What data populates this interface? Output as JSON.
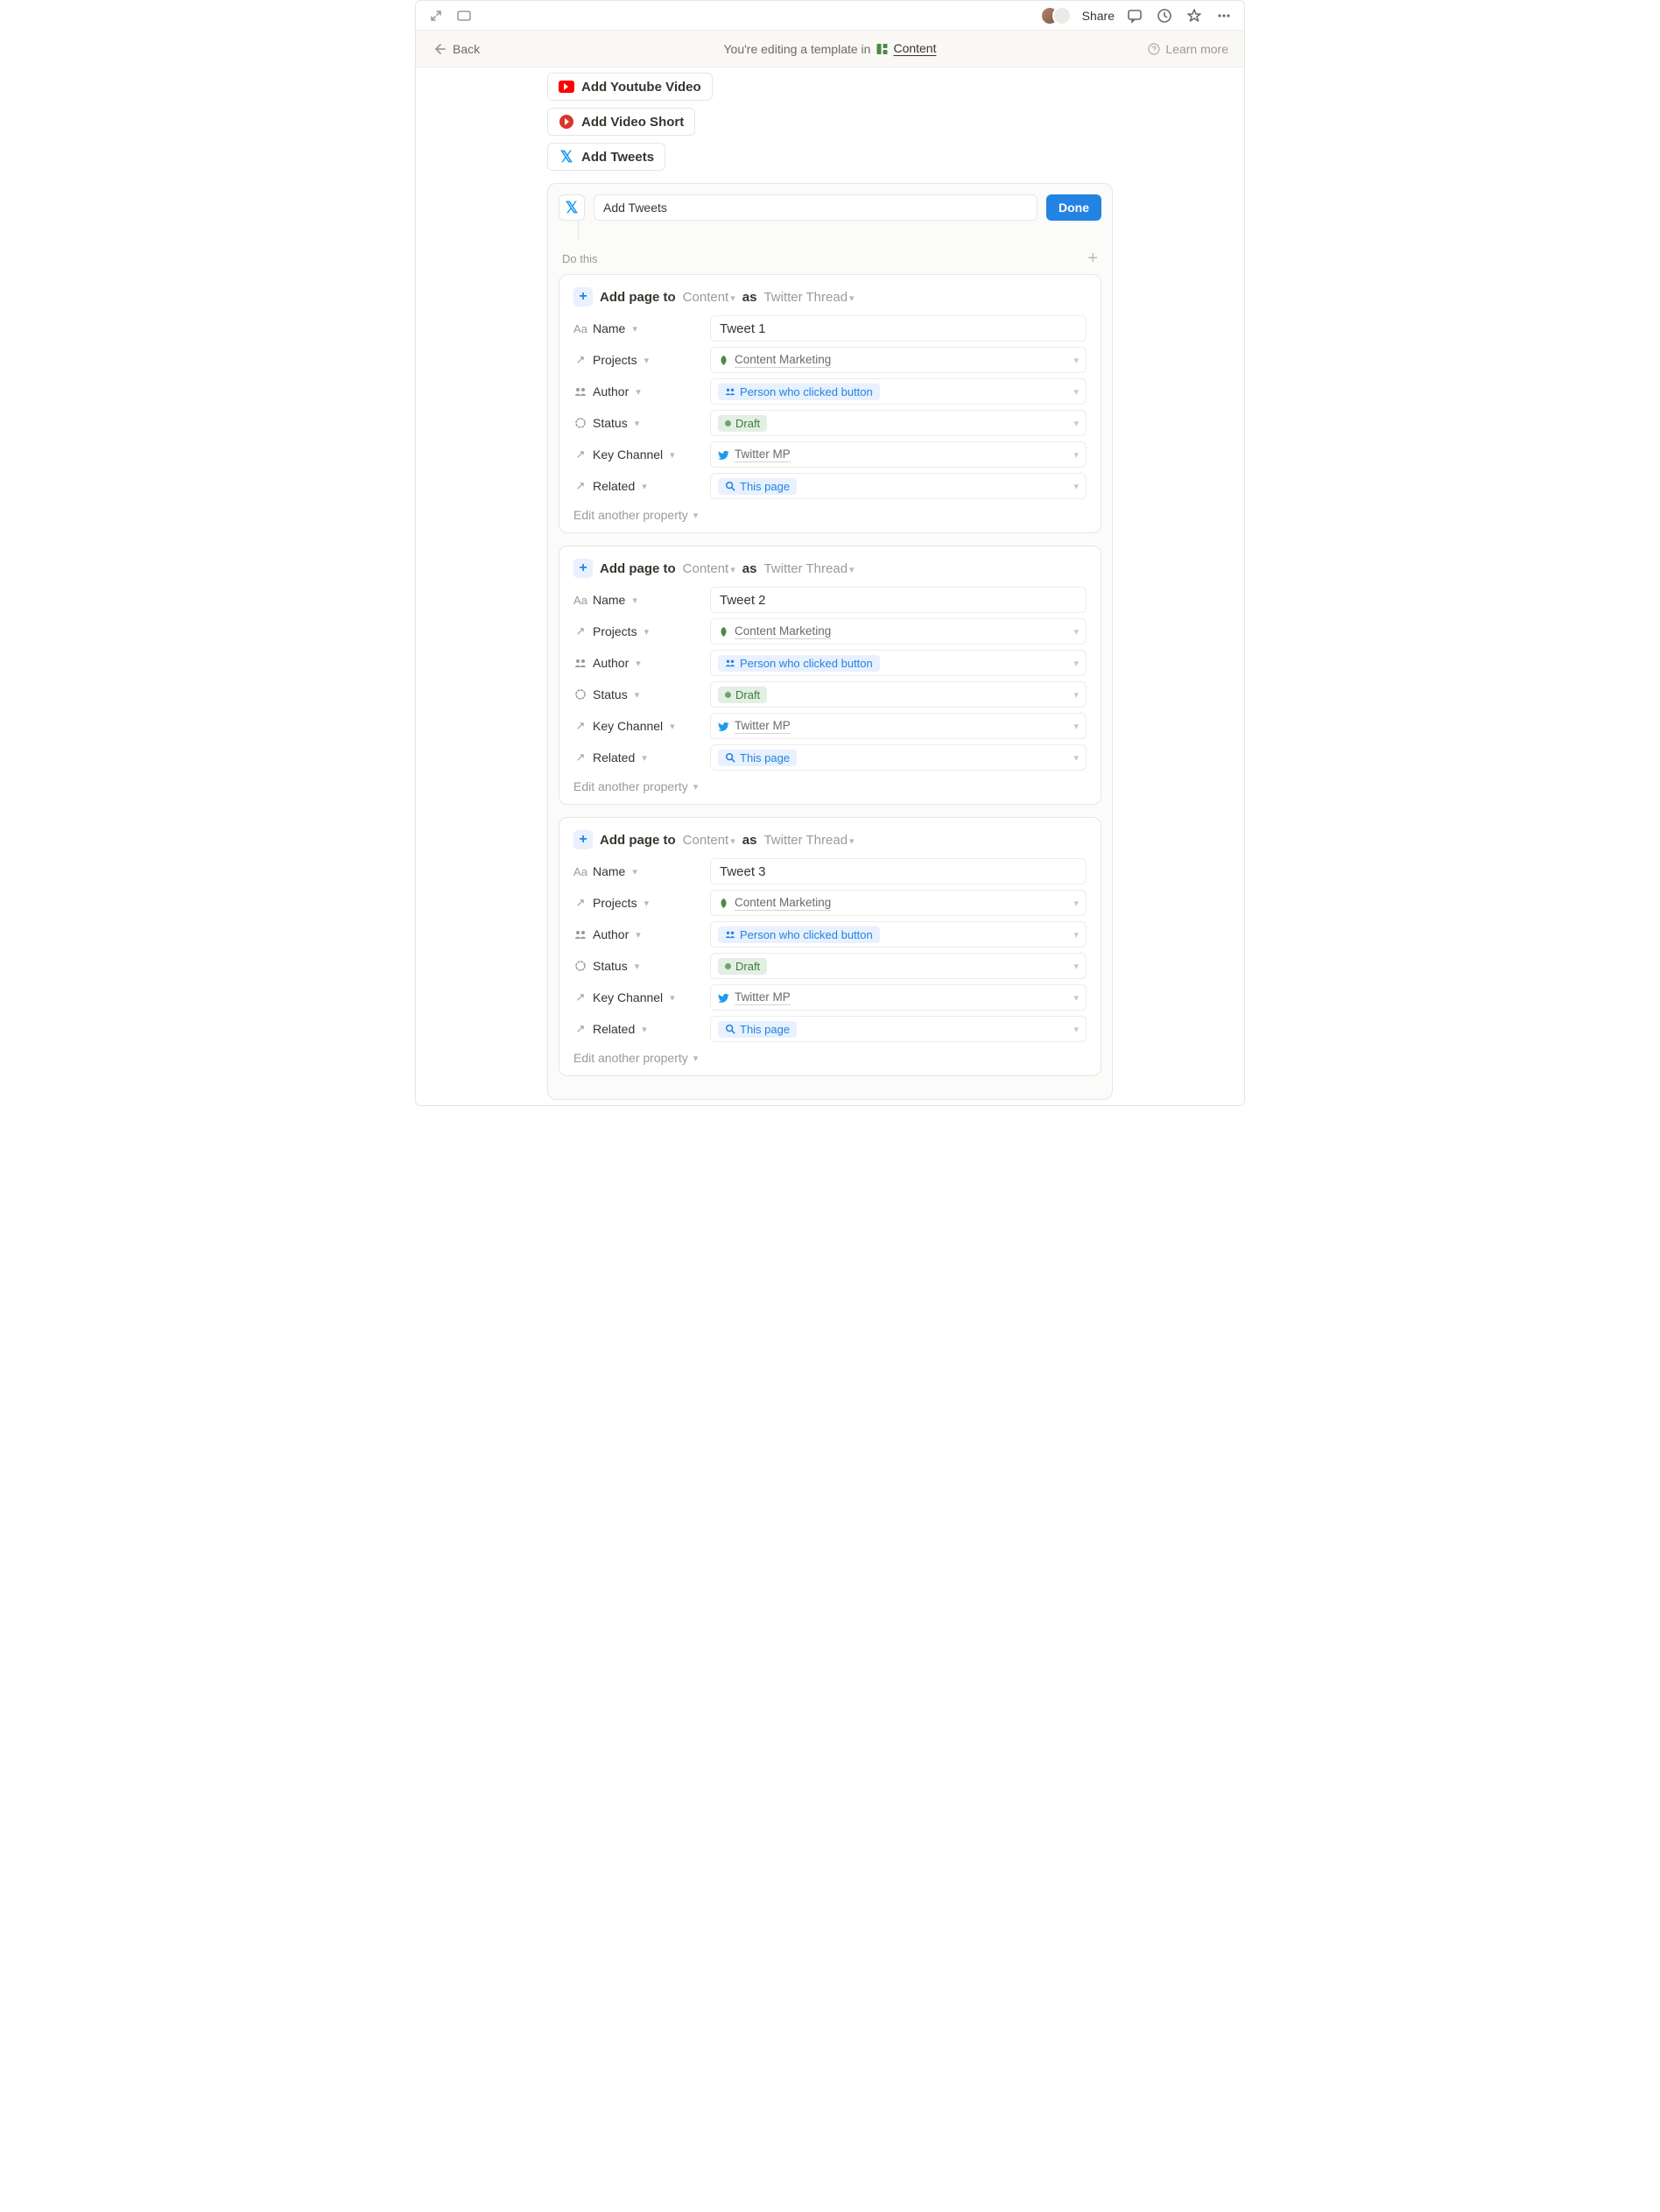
{
  "topbar": {
    "share": "Share"
  },
  "banner": {
    "back": "Back",
    "text_prefix": "You're editing a template in",
    "db_name": "Content",
    "learn_more": "Learn more"
  },
  "buttons": {
    "youtube": "Add Youtube Video",
    "short": "Add Video Short",
    "tweets": "Add Tweets"
  },
  "automation": {
    "trigger_label": "Add Tweets",
    "done": "Done",
    "do_this": "Do this"
  },
  "card_common": {
    "add_page_to": "Add page to",
    "db": "Content",
    "as": "as",
    "template": "Twitter Thread",
    "edit_another": "Edit another property",
    "labels": {
      "name": "Name",
      "projects": "Projects",
      "author": "Author",
      "status": "Status",
      "key_channel": "Key Channel",
      "related": "Related"
    },
    "values": {
      "projects": "Content Marketing",
      "author": "Person who clicked button",
      "status": "Draft",
      "key_channel": "Twitter MP",
      "related": "This page"
    }
  },
  "cards": [
    {
      "name_value": "Tweet 1"
    },
    {
      "name_value": "Tweet 2"
    },
    {
      "name_value": "Tweet 3"
    }
  ]
}
